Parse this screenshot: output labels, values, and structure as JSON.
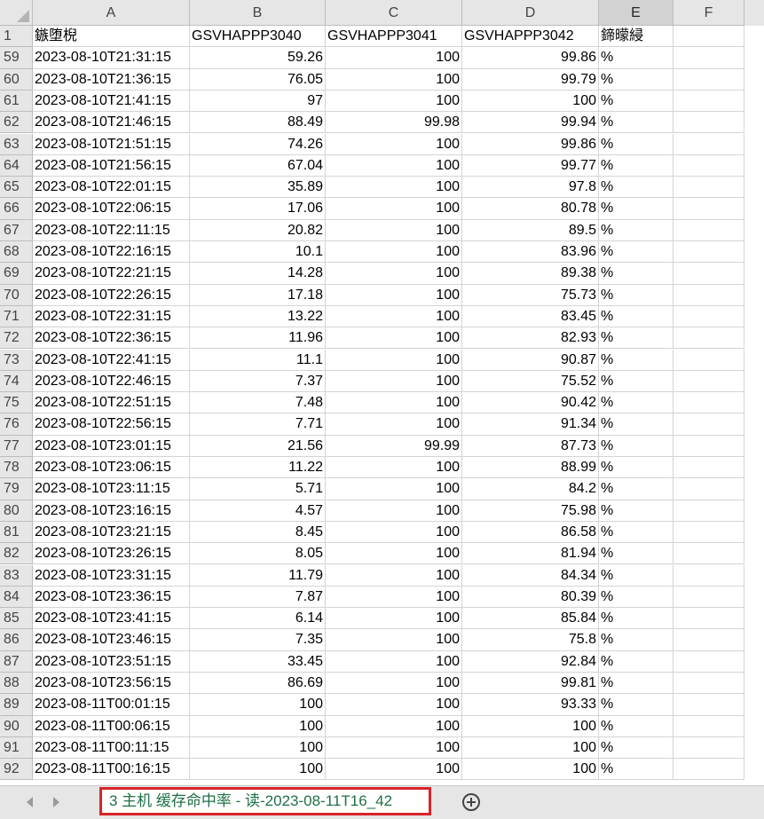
{
  "columns": [
    "A",
    "B",
    "C",
    "D",
    "E",
    "F"
  ],
  "selected_column": "E",
  "header_row": {
    "row_number": "1",
    "cells": [
      "鏃堕棿",
      "GSVHAPPP3040",
      "GSVHAPPP3041",
      "GSVHAPPP3042",
      "鍗曚綅",
      ""
    ]
  },
  "rows": [
    {
      "n": "59",
      "a": "2023-08-10T21:31:15",
      "b": "59.26",
      "c": "100",
      "d": "99.86",
      "e": "%"
    },
    {
      "n": "60",
      "a": "2023-08-10T21:36:15",
      "b": "76.05",
      "c": "100",
      "d": "99.79",
      "e": "%"
    },
    {
      "n": "61",
      "a": "2023-08-10T21:41:15",
      "b": "97",
      "c": "100",
      "d": "100",
      "e": "%"
    },
    {
      "n": "62",
      "a": "2023-08-10T21:46:15",
      "b": "88.49",
      "c": "99.98",
      "d": "99.94",
      "e": "%"
    },
    {
      "n": "63",
      "a": "2023-08-10T21:51:15",
      "b": "74.26",
      "c": "100",
      "d": "99.86",
      "e": "%"
    },
    {
      "n": "64",
      "a": "2023-08-10T21:56:15",
      "b": "67.04",
      "c": "100",
      "d": "99.77",
      "e": "%"
    },
    {
      "n": "65",
      "a": "2023-08-10T22:01:15",
      "b": "35.89",
      "c": "100",
      "d": "97.8",
      "e": "%"
    },
    {
      "n": "66",
      "a": "2023-08-10T22:06:15",
      "b": "17.06",
      "c": "100",
      "d": "80.78",
      "e": "%"
    },
    {
      "n": "67",
      "a": "2023-08-10T22:11:15",
      "b": "20.82",
      "c": "100",
      "d": "89.5",
      "e": "%"
    },
    {
      "n": "68",
      "a": "2023-08-10T22:16:15",
      "b": "10.1",
      "c": "100",
      "d": "83.96",
      "e": "%"
    },
    {
      "n": "69",
      "a": "2023-08-10T22:21:15",
      "b": "14.28",
      "c": "100",
      "d": "89.38",
      "e": "%"
    },
    {
      "n": "70",
      "a": "2023-08-10T22:26:15",
      "b": "17.18",
      "c": "100",
      "d": "75.73",
      "e": "%"
    },
    {
      "n": "71",
      "a": "2023-08-10T22:31:15",
      "b": "13.22",
      "c": "100",
      "d": "83.45",
      "e": "%"
    },
    {
      "n": "72",
      "a": "2023-08-10T22:36:15",
      "b": "11.96",
      "c": "100",
      "d": "82.93",
      "e": "%"
    },
    {
      "n": "73",
      "a": "2023-08-10T22:41:15",
      "b": "11.1",
      "c": "100",
      "d": "90.87",
      "e": "%"
    },
    {
      "n": "74",
      "a": "2023-08-10T22:46:15",
      "b": "7.37",
      "c": "100",
      "d": "75.52",
      "e": "%"
    },
    {
      "n": "75",
      "a": "2023-08-10T22:51:15",
      "b": "7.48",
      "c": "100",
      "d": "90.42",
      "e": "%"
    },
    {
      "n": "76",
      "a": "2023-08-10T22:56:15",
      "b": "7.71",
      "c": "100",
      "d": "91.34",
      "e": "%"
    },
    {
      "n": "77",
      "a": "2023-08-10T23:01:15",
      "b": "21.56",
      "c": "99.99",
      "d": "87.73",
      "e": "%"
    },
    {
      "n": "78",
      "a": "2023-08-10T23:06:15",
      "b": "11.22",
      "c": "100",
      "d": "88.99",
      "e": "%"
    },
    {
      "n": "79",
      "a": "2023-08-10T23:11:15",
      "b": "5.71",
      "c": "100",
      "d": "84.2",
      "e": "%"
    },
    {
      "n": "80",
      "a": "2023-08-10T23:16:15",
      "b": "4.57",
      "c": "100",
      "d": "75.98",
      "e": "%"
    },
    {
      "n": "81",
      "a": "2023-08-10T23:21:15",
      "b": "8.45",
      "c": "100",
      "d": "86.58",
      "e": "%"
    },
    {
      "n": "82",
      "a": "2023-08-10T23:26:15",
      "b": "8.05",
      "c": "100",
      "d": "81.94",
      "e": "%"
    },
    {
      "n": "83",
      "a": "2023-08-10T23:31:15",
      "b": "11.79",
      "c": "100",
      "d": "84.34",
      "e": "%"
    },
    {
      "n": "84",
      "a": "2023-08-10T23:36:15",
      "b": "7.87",
      "c": "100",
      "d": "80.39",
      "e": "%"
    },
    {
      "n": "85",
      "a": "2023-08-10T23:41:15",
      "b": "6.14",
      "c": "100",
      "d": "85.84",
      "e": "%"
    },
    {
      "n": "86",
      "a": "2023-08-10T23:46:15",
      "b": "7.35",
      "c": "100",
      "d": "75.8",
      "e": "%"
    },
    {
      "n": "87",
      "a": "2023-08-10T23:51:15",
      "b": "33.45",
      "c": "100",
      "d": "92.84",
      "e": "%"
    },
    {
      "n": "88",
      "a": "2023-08-10T23:56:15",
      "b": "86.69",
      "c": "100",
      "d": "99.81",
      "e": "%"
    },
    {
      "n": "89",
      "a": "2023-08-11T00:01:15",
      "b": "100",
      "c": "100",
      "d": "93.33",
      "e": "%"
    },
    {
      "n": "90",
      "a": "2023-08-11T00:06:15",
      "b": "100",
      "c": "100",
      "d": "100",
      "e": "%"
    },
    {
      "n": "91",
      "a": "2023-08-11T00:11:15",
      "b": "100",
      "c": "100",
      "d": "100",
      "e": "%"
    },
    {
      "n": "92",
      "a": "2023-08-11T00:16:15",
      "b": "100",
      "c": "100",
      "d": "100",
      "e": "%"
    }
  ],
  "sheet_tab": {
    "label": "3 主机 缓存命中率 - 读-2023-08-11T16_42",
    "text_color": "#1e7145",
    "highlight_color": "#d9232a"
  },
  "icons": {
    "prev_sheet": "triangle-left-icon",
    "next_sheet": "triangle-right-icon",
    "new_sheet": "plus-circle-icon",
    "select_all": "select-all-triangle-icon"
  }
}
